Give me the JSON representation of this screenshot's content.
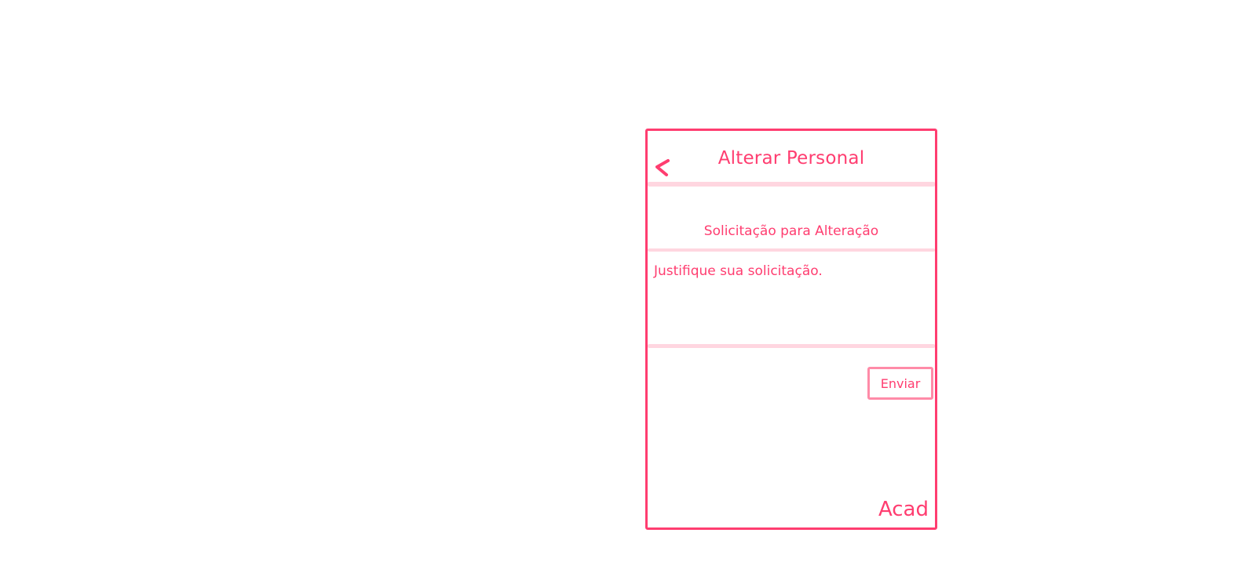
{
  "header": {
    "title": "Alterar Personal",
    "back_icon": "chevron-left-icon"
  },
  "form": {
    "section_title": "Solicitação para Alteração",
    "justification_placeholder": "Justifique sua solicitação.",
    "send_label": "Enviar"
  },
  "footer": {
    "brand": "Acad"
  },
  "colors": {
    "accent": "#ff3d70",
    "divider": "#ffd6e0",
    "button_border": "#ff8ba8"
  }
}
